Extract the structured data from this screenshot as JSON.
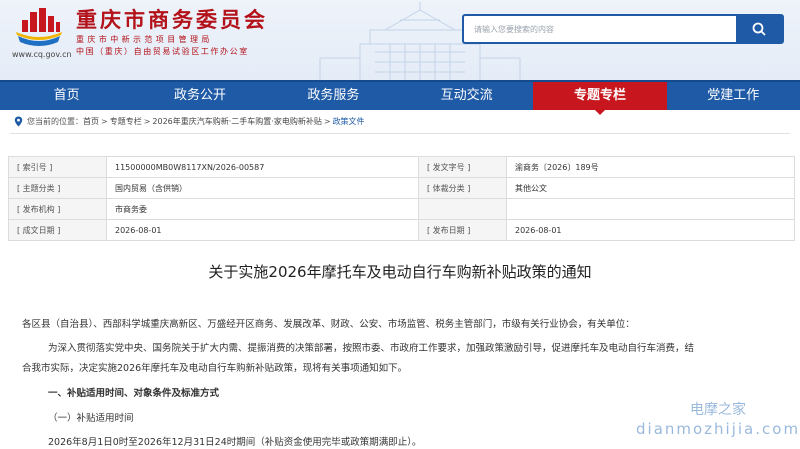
{
  "header": {
    "site_name": "重庆市商务委员会",
    "subtitle_line1": "重庆市中新示范项目管理局",
    "subtitle_line2": "中国（重庆）自由贸易试验区工作办公室",
    "domain": "www.cq.gov.cn",
    "search_placeholder": "请输入您要搜索的内容"
  },
  "nav": [
    {
      "label": "首页",
      "active": false
    },
    {
      "label": "政务公开",
      "active": false
    },
    {
      "label": "政务服务",
      "active": false
    },
    {
      "label": "互动交流",
      "active": false
    },
    {
      "label": "专题专栏",
      "active": true
    },
    {
      "label": "党建工作",
      "active": false
    }
  ],
  "breadcrumb": {
    "prefix": "您当前的位置：",
    "items": [
      "首页",
      "专题专栏",
      "2026年重庆汽车购新·二手车购置·家电购新补贴",
      "政策文件"
    ]
  },
  "meta": {
    "rows": [
      [
        {
          "label": "[ 索引号 ]",
          "value": "11500000MB0W8117XN/2026-00587"
        },
        {
          "label": "[ 发文字号 ]",
          "value": "渝商务〔2026〕189号"
        }
      ],
      [
        {
          "label": "[ 主题分类 ]",
          "value": "国内贸易（含供销）"
        },
        {
          "label": "[ 体裁分类 ]",
          "value": "其他公文"
        }
      ],
      [
        {
          "label": "[ 发布机构 ]",
          "value": "市商务委"
        },
        {
          "label": "",
          "value": ""
        }
      ],
      [
        {
          "label": "[ 成文日期 ]",
          "value": "2026-08-01"
        },
        {
          "label": "[ 发布日期 ]",
          "value": "2026-08-01"
        }
      ]
    ]
  },
  "document": {
    "title": "关于实施2026年摩托车及电动自行车购新补贴政策的通知",
    "addressee": "各区县（自治县）、西部科学城重庆高新区、万盛经开区商务、发展改革、财政、公安、市场监管、税务主管部门，市级有关行业协会，有关单位：",
    "intro_line1": "为深入贯彻落实党中央、国务院关于扩大内需、提振消费的决策部署，按照市委、市政府工作要求，加强政策激励引导，促进摩托车及电动自行车消费，结",
    "intro_line2": "合我市实际，决定实施2026年摩托车及电动自行车购新补贴政策，现将有关事项通知如下。",
    "section1": "一、补贴适用时间、对象条件及标准方式",
    "subsection1": "（一）补贴适用时间",
    "period": "2026年8月1日0时至2026年12月31日24时期间（补贴资金使用完毕或政策期满即止）。"
  },
  "watermark": {
    "cn": "电摩之家",
    "en": "dianmozhijia.com"
  },
  "colors": {
    "brand_red": "#c8161e",
    "nav_blue": "#1f5aa6"
  }
}
